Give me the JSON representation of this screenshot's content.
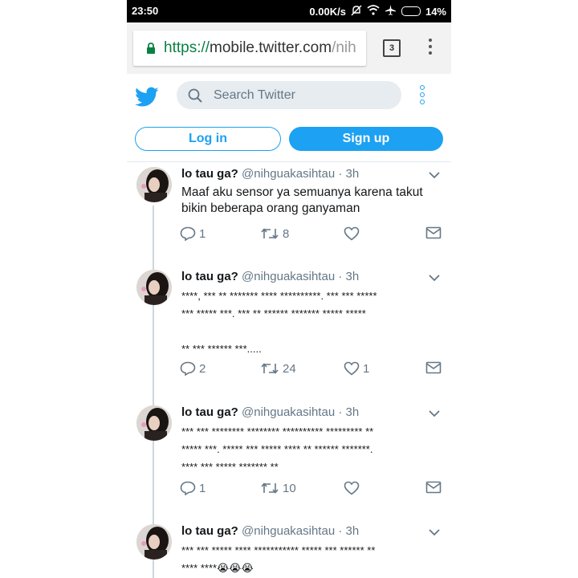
{
  "status_bar": {
    "time": "23:50",
    "net_speed": "0.00K/s",
    "battery": "14%"
  },
  "browser": {
    "url_scheme": "https://",
    "url_host": "mobile.twitter.com",
    "url_path": "/nih",
    "tab_count": "3"
  },
  "header": {
    "search_placeholder": "Search Twitter",
    "login_label": "Log in",
    "signup_label": "Sign up"
  },
  "colors": {
    "brand": "#1da1f2",
    "text": "#14171a",
    "secondary": "#657786",
    "secure": "#0b8043"
  },
  "tweets": [
    {
      "name": "lo tau ga?",
      "handle": "@nihguakasihtau",
      "time": "· 3h",
      "lines": [
        "Maaf aku sensor ya semuanya karena takut",
        "bikin beberapa orang ganyaman"
      ],
      "replies": "1",
      "retweets": "8",
      "likes": ""
    },
    {
      "name": "lo tau ga?",
      "handle": "@nihguakasihtau",
      "time": "· 3h",
      "lines": [
        "****, *** ** ******* **** **********. *** *** *****",
        "*** ***** ***. *** ** ****** ******* ***** *****",
        "",
        "** *** ****** ***....."
      ],
      "replies": "2",
      "retweets": "24",
      "likes": "1"
    },
    {
      "name": "lo tau ga?",
      "handle": "@nihguakasihtau",
      "time": "· 3h",
      "lines": [
        "*** *** ******** ******** ********** ********* **",
        "***** ***. ***** *** ***** **** ** ****** *******.",
        "**** *** ***** ******* **"
      ],
      "replies": "1",
      "retweets": "10",
      "likes": ""
    },
    {
      "name": "lo tau ga?",
      "handle": "@nihguakasihtau",
      "time": "· 3h",
      "lines": [
        "*** *** ***** **** *********** ***** *** ****** **",
        "**** ****😭😭😭"
      ],
      "replies": "",
      "retweets": "",
      "likes": ""
    }
  ]
}
